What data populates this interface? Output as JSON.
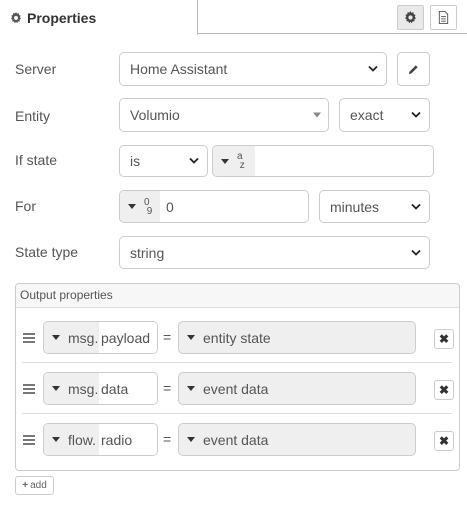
{
  "header": {
    "title": "Properties",
    "icons": {
      "settings": "gear-icon",
      "description": "document-icon"
    }
  },
  "form": {
    "server": {
      "label": "Server",
      "value": "Home Assistant",
      "edit_icon": "pencil-icon"
    },
    "entity": {
      "label": "Entity",
      "value": "Volumio",
      "match": "exact"
    },
    "if_state": {
      "label": "If state",
      "operator": "is",
      "value": "",
      "type_icon": "string-type-icon",
      "type_glyph_top": "a",
      "type_glyph_bottom": "z"
    },
    "for": {
      "label": "For",
      "value": "0",
      "unit": "minutes",
      "type_icon": "number-type-icon",
      "type_glyph_top": "0",
      "type_glyph_bottom": "9"
    },
    "state_type": {
      "label": "State type",
      "value": "string"
    }
  },
  "output": {
    "title": "Output properties",
    "rows": [
      {
        "prefix": "msg.",
        "name": "payload",
        "eq": "=",
        "value": "entity state"
      },
      {
        "prefix": "msg.",
        "name": "data",
        "eq": "=",
        "value": "event data"
      },
      {
        "prefix": "flow.",
        "name": "radio",
        "eq": "=",
        "value": "event data"
      }
    ],
    "add_label": "add"
  },
  "colors": {
    "border": "#cccccc",
    "field_gray": "#efefef",
    "text": "#555555"
  }
}
